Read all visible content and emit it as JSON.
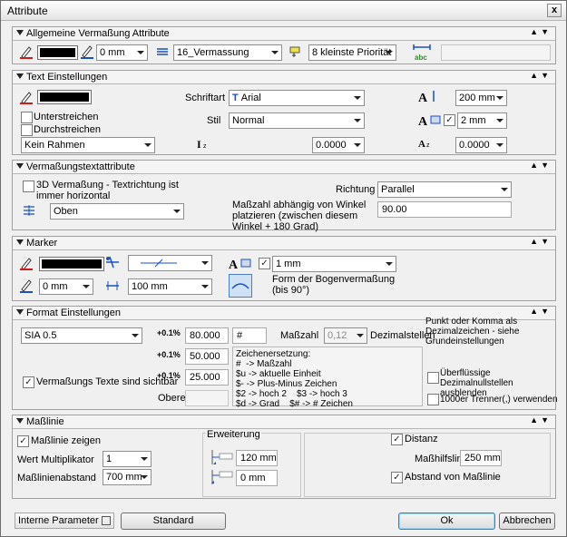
{
  "window": {
    "title": "Attribute",
    "close_glyph": "x"
  },
  "common": {
    "dropdown_glyph": "▾",
    "panel_controls": "▲▼"
  },
  "sections": {
    "allgemein": {
      "title": "Allgemeine Vermaßung Attribute",
      "pen_width": "0 mm",
      "layer": "16_Vermassung",
      "priority": "8 kleinste Priorität",
      "text_field": ""
    },
    "text": {
      "title": "Text Einstellungen",
      "underline_label": "Unterstreichen",
      "strikethrough_label": "Durchstreichen",
      "frame": "Kein Rahmen",
      "font_label": "Schriftart",
      "font_value": "Arial",
      "style_label": "Stil",
      "style_value": "Normal",
      "height_value": "200 mm",
      "width_value": "2 mm",
      "italic_value": "0.0000",
      "spacing_value": "0.0000"
    },
    "vermassungstext": {
      "title": "Vermaßungstextattribute",
      "three_d_label": "3D Vermaßung - Textrichtung ist immer horizontal",
      "position_value": "Oben",
      "direction_label": "Richtung",
      "direction_value": "Parallel",
      "angle_label": "Maßzahl abhängig von Winkel platzieren (zwischen diesem Winkel + 180 Grad)",
      "angle_value": "90.00"
    },
    "marker": {
      "title": "Marker",
      "pen_width": "0 mm",
      "marker_size": "100 mm",
      "text_size": "1 mm",
      "arc_label": "Form der Bogenvermaßung (bis 90°)"
    },
    "format": {
      "title": "Format Einstellungen",
      "unit": "SIA 0.5",
      "upper_value": "80.000",
      "middle_value": "50.000",
      "lower_value": "25.000",
      "hash_value": "#",
      "masszahl_label": "Maßzahl",
      "decimals_value": "0,12",
      "decimals_label": "Dezimalstellen",
      "obere_label": "Obere",
      "obere_value": "",
      "visible_label": "Vermaßungs Texte sind sichtbar",
      "hint": "Punkt oder Komma als Dezimalzeichen - siehe Grundeinstellungen",
      "substitution": "Zeichenersetzung:\n#  -> Maßzahl\n$u -> aktuelle Einheit\n$- -> Plus-Minus Zeichen\n$2 -> hoch 2    $3 -> hoch 3\n$d -> Grad    $# -> # Zeichen",
      "hide_zeros_label": "Überflüssige Dezimalnullstellen ausblenden",
      "thousands_label": "1000er Trenner(,) verwenden",
      "tick_label": "+0.1",
      "tick_unit": "%"
    },
    "masslinie": {
      "title": "Maßlinie",
      "show_label": "Maßlinie zeigen",
      "multiplier_label": "Wert Multiplikator",
      "multiplier_value": "1",
      "distance_label": "Maßlinienabstand",
      "distance_value": "700 mm",
      "extension_label": "Erweiterung",
      "extension_value1": "120 mm",
      "extension_value2": "0 mm",
      "distanz_label": "Distanz",
      "hilfslinie_label": "Maßhilfslinie",
      "hilfslinie_value": "250 mm",
      "abstand_label": "Abstand von Maßlinie"
    }
  },
  "footer": {
    "params_label": "Interne Parameter",
    "standard_label": "Standard",
    "ok_label": "Ok",
    "cancel_label": "Abbrechen"
  },
  "colors": {
    "accent": "#3c7fb1",
    "pen_red": "#d21a1a",
    "pen_blue": "#1b4fc2"
  }
}
